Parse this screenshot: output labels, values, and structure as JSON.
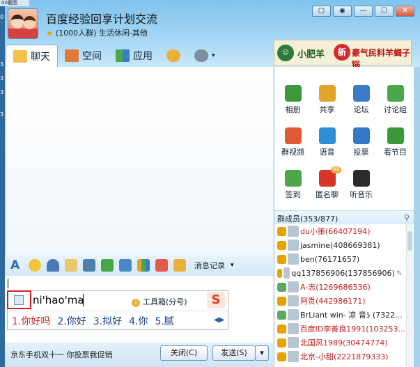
{
  "window": {
    "corner_tab": "00截图",
    "left_strip_chars": [
      "0",
      "3",
      "3",
      "3",
      "3",
      "3",
      "3",
      "3",
      "3"
    ],
    "min_label": "▢",
    "skin_label": "◉",
    "minimize_label": "—",
    "maximize_label": "☐",
    "close_label": "✕"
  },
  "header": {
    "group_name": "百度经验回享计划交流",
    "group_info": "(1000人群) 生活休闲-其他"
  },
  "tabs": [
    {
      "label": "聊天",
      "icon": "chat-icon"
    },
    {
      "label": "空间",
      "icon": "home-icon"
    },
    {
      "label": "应用",
      "icon": "apps-icon"
    }
  ],
  "banner": {
    "logo_text": "小肥羊",
    "brand": "小肥羊",
    "badge": "新",
    "slogan": "豪气民料羊蝎子锅"
  },
  "toolbar": {
    "history_label": "消息记录"
  },
  "ime": {
    "pinyin": "ni'hao'ma",
    "toolbox": "工具箱(分号)",
    "candidates": [
      "1.你好吗",
      "2.你好",
      "3.拟好",
      "4.你",
      "5.腻"
    ],
    "logo": "S",
    "tools_icon_text": "i"
  },
  "bottom": {
    "hint": "京东手机双十一 你投票我促销",
    "close_label": "关闭(C)",
    "send_label": "发送(S)",
    "send_arrow": "▾"
  },
  "apps": [
    {
      "label": "相册",
      "color": "#3c9a3c",
      "icon": "photo-album-icon"
    },
    {
      "label": "共享",
      "color": "#e3a42b",
      "icon": "shared-folder-icon"
    },
    {
      "label": "论坛",
      "color": "#3a7cc9",
      "icon": "forum-icon"
    },
    {
      "label": "讨论组",
      "color": "#4aa84a",
      "icon": "discussion-group-icon"
    },
    {
      "label": "群视频",
      "color": "#e05a36",
      "icon": "group-video-icon"
    },
    {
      "label": "语音",
      "color": "#2d8ed6",
      "icon": "voice-icon"
    },
    {
      "label": "投票",
      "color": "#3479c8",
      "icon": "vote-icon"
    },
    {
      "label": "看节目",
      "color": "#3a9a3a",
      "icon": "show-icon"
    },
    {
      "label": "签到",
      "color": "#4aa84a",
      "icon": "checkin-icon"
    },
    {
      "label": "匿名聊",
      "color": "#d8342a",
      "icon": "anonymous-chat-icon",
      "badge": "99"
    },
    {
      "label": "听音乐",
      "color": "#2b2b2b",
      "icon": "music-icon"
    }
  ],
  "members_header": {
    "label": "群成员(353/877)"
  },
  "members": [
    {
      "name": "du小策(66407194)",
      "red": true,
      "role": "#e6a300"
    },
    {
      "name": "jasmine(408669381)",
      "red": false,
      "role": "#e6a300"
    },
    {
      "name": "ben(76171657)",
      "red": false,
      "role": "#e6a300"
    },
    {
      "name": "qq137856906(137856906)",
      "red": false,
      "role": "#e6a300"
    },
    {
      "name": "A-志(1269686536)",
      "red": true,
      "role": "#5fa85f"
    },
    {
      "name": "阿贵(442986171)",
      "red": true,
      "role": "#e6a300"
    },
    {
      "name": "BrLiant win- 凉 音ʖ (7322...",
      "red": false,
      "role": "#5fa85f"
    },
    {
      "name": "百度ID李善良1991(103253...",
      "red": true,
      "role": "#e6a300"
    },
    {
      "name": "北国风1989(30474774)",
      "red": true,
      "role": "#e6a300"
    },
    {
      "name": "北京-小甜(2221879333)",
      "red": true,
      "role": "#e6a300"
    }
  ],
  "colors": {
    "accent": "#7fc3ee",
    "red_name": "#c41d1d",
    "highlight_box": "#d61f1f"
  }
}
